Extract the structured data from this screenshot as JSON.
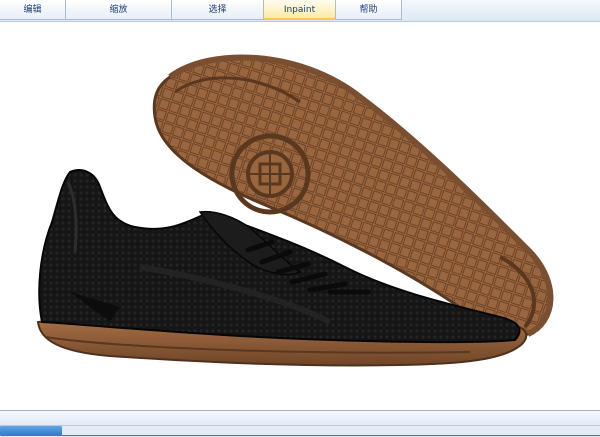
{
  "toolbar": {
    "tabs": [
      {
        "label": "编辑"
      },
      {
        "label": "缩放"
      },
      {
        "label": "选择"
      },
      {
        "label": "Inpaint"
      },
      {
        "label": "帮助"
      }
    ]
  },
  "canvas": {
    "image_subject": "black-indoor-soccer-shoe-icon",
    "colors": {
      "upper": "#141414",
      "sole": "#9a6640",
      "sole_dark": "#7a4e30",
      "background": "#ffffff"
    }
  },
  "status": {
    "scroll_position": 0
  },
  "colors": {
    "toolbar_bg": "#dde7f4",
    "tab_text": "#1e3c72",
    "active_tab": "#fbe9a6",
    "scroll_thumb": "#2f78c8"
  }
}
